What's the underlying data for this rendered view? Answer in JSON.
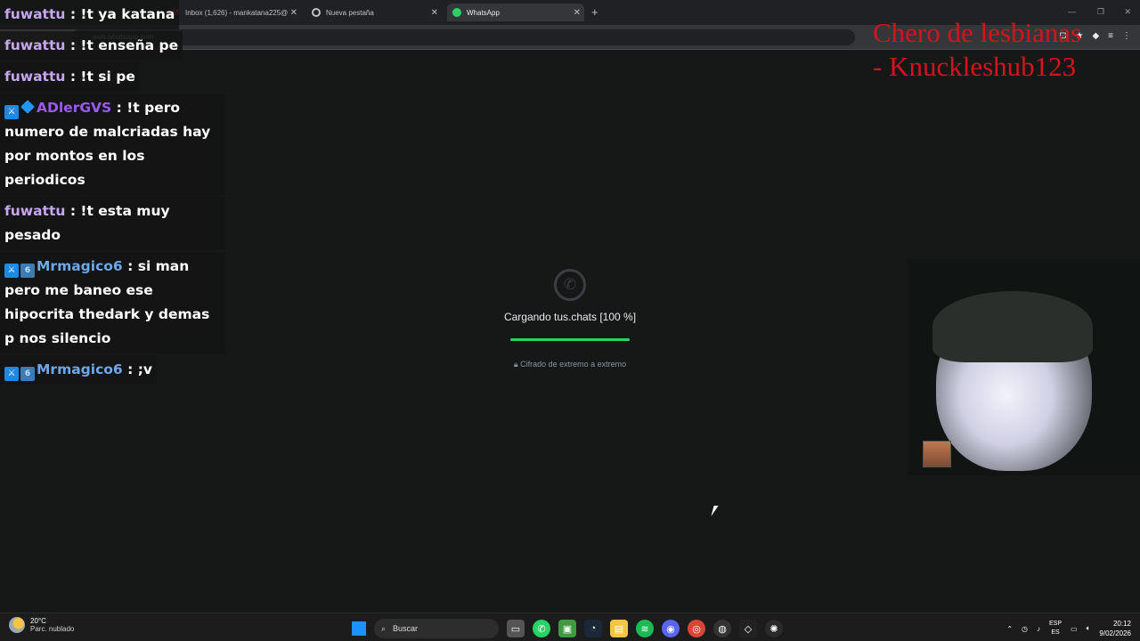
{
  "browser": {
    "tabs": [
      {
        "label": "Inbox (1,626) - mankatana225@",
        "icon": "gmail-icon",
        "active": false
      },
      {
        "label": "Nueva pestaña",
        "icon": "chrome-icon",
        "active": false
      },
      {
        "label": "WhatsApp",
        "icon": "whatsapp-icon",
        "active": true
      }
    ],
    "new_tab": "+",
    "close": "✕",
    "url": "web.whatsapp.com"
  },
  "chat": [
    {
      "user": "fuwattu",
      "color": "#c6a6f0",
      "text": "!t ya katana",
      "badges": []
    },
    {
      "user": "fuwattu",
      "color": "#c6a6f0",
      "text": "!t enseña pe",
      "badges": []
    },
    {
      "user": "fuwattu",
      "color": "#c6a6f0",
      "text": "!t si pe",
      "badges": []
    },
    {
      "user": "ADlerGVS",
      "color": "#9b59f5",
      "text": "!t pero numero de malcriadas hay por montos en los periodicos",
      "badges": [
        "mod",
        "cube"
      ]
    },
    {
      "user": "fuwattu",
      "color": "#c6a6f0",
      "text": "!t esta muy pesado",
      "badges": []
    },
    {
      "user": "Mrmagico6",
      "color": "#6ea7e8",
      "text": "si man pero me baneo ese hipocrita thedark y demas p nos silencio",
      "badges": [
        "mod",
        "sub"
      ]
    },
    {
      "user": "Mrmagico6",
      "color": "#6ea7e8",
      "text": ";v",
      "badges": [
        "mod",
        "sub"
      ]
    }
  ],
  "overlay_title": {
    "line1": "Chero de lesbianas",
    "line2": "- Knuckleshub123"
  },
  "whatsapp": {
    "loading_text": "Cargando tus.chats [100 %]",
    "progress": 1.0,
    "secure_text": "Cifrado de extremo a extremo"
  },
  "taskbar": {
    "weather_temp": "20°C",
    "weather_desc": "Parc. nublado",
    "search_placeholder": "Buscar",
    "lang_top": "ESP",
    "lang_bottom": "ES",
    "time": "20:12",
    "date": "9/02/2026"
  },
  "colors": {
    "wa_green": "#25d366",
    "overlay_red": "#d4141c",
    "background": "#161717"
  }
}
